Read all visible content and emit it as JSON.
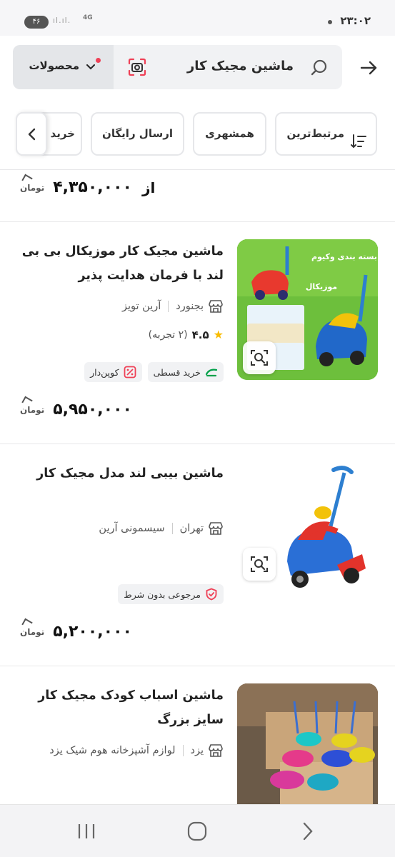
{
  "status_bar": {
    "time": "۲۳:۰۲",
    "battery": "۴۶",
    "network": "4G"
  },
  "header": {
    "search_query": "ماشین مجیک کار",
    "category_label": "محصولات"
  },
  "filters": {
    "sort_label": "مرتبط‌ترین",
    "chips": [
      "همشهری",
      "ارسال رایگان",
      "خرید"
    ]
  },
  "previous_item": {
    "from_label": "از",
    "price": "۴,۳۵۰,۰۰۰",
    "currency": "تومان"
  },
  "products": [
    {
      "title": "ماشین مجیک کار موزیکال بی بی لند با فرمان هدایت پذیر",
      "city": "بجنورد",
      "shop": "آرین تویز",
      "rating": "۴.۵",
      "reviews": "(۲ تجربه)",
      "badges": [
        "خرید قسطی",
        "کوپن‌دار"
      ],
      "price": "۵,۹۵۰,۰۰۰",
      "currency": "تومان",
      "image_text_top": "بسته بندی وکیوم",
      "image_text_bottom": "موزیکال"
    },
    {
      "title": "ماشین بیبی لند مدل مجیک کار",
      "city": "تهران",
      "shop": "سیسمونی آرین",
      "badges": [
        "مرجوعی بدون شرط"
      ],
      "price": "۵,۲۰۰,۰۰۰",
      "currency": "تومان"
    },
    {
      "title": "ماشین اسباب کودک مجیک کار سایز بزرگ",
      "city": "یزد",
      "shop": "لوازم آشپزخانه هوم شیک یزد"
    }
  ],
  "colors": {
    "accent": "#ef4056",
    "star": "#f9bc00",
    "installment_green": "#00a049"
  },
  "icons": {
    "back": "arrow-right-icon",
    "search": "search-icon",
    "camera": "camera-search-icon",
    "sort": "sort-icon",
    "shop": "shop-icon",
    "similar": "image-search-icon"
  }
}
